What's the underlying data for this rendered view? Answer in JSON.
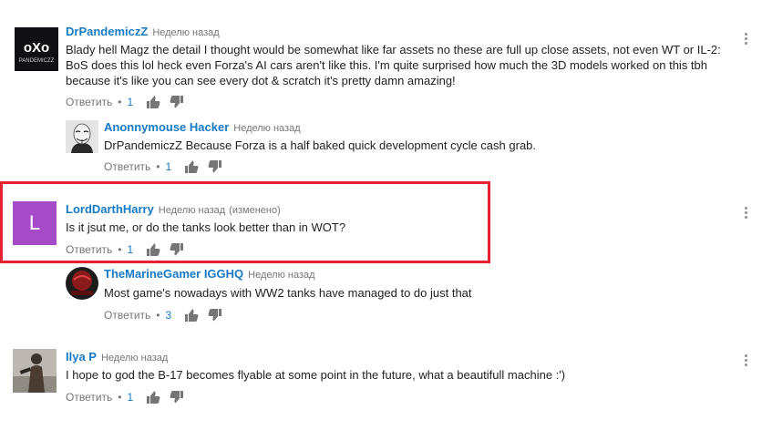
{
  "comments": [
    {
      "author": "DrPandemiczZ",
      "time": "Неделю назад",
      "text": "Blady hell Magz the detail I thought would be somewhat like far assets no these are full up close assets, not even WT or IL-2: BoS does this lol heck even Forza's AI cars aren't like this. I'm quite surprised how much the 3D models worked on this tbh because it's like you can see every dot & scratch it's pretty damn amazing!",
      "reply_label": "Ответить",
      "separator": "•",
      "likes": "1",
      "avatar_text": "oXo",
      "avatar_subtext": "PANDEMICZZ",
      "avatar_color": "#0f0f14"
    },
    {
      "author": "Anonnymouse Hacker",
      "time": "Неделю назад",
      "text": "DrPandemiczZ Because Forza is a half baked quick development cycle cash grab.",
      "reply_label": "Ответить",
      "separator": "•",
      "likes": "1"
    },
    {
      "author": "LordDarthHarry",
      "time": "Неделю назад",
      "edited": "(изменено)",
      "text": "Is it jsut me, or do the tanks look better than in WOT?",
      "reply_label": "Ответить",
      "separator": "•",
      "likes": "1",
      "avatar_letter": "L",
      "avatar_color": "#a64bc7"
    },
    {
      "author": "TheMarineGamer IGGHQ",
      "time": "Неделю назад",
      "text": "Most game's nowadays with WW2 tanks have managed to do just that",
      "reply_label": "Ответить",
      "separator": "•",
      "likes": "3",
      "avatar_color": "#8b1a1a"
    },
    {
      "author": "Ilya P",
      "time": "Неделю назад",
      "text": "I hope to god the B-17 becomes flyable at some point in the future, what a beautifull machine :')",
      "reply_label": "Ответить",
      "separator": "•",
      "likes": "1"
    }
  ],
  "colors": {
    "link": "#167ac6",
    "meta": "#767676",
    "highlight": "#e8212e"
  }
}
